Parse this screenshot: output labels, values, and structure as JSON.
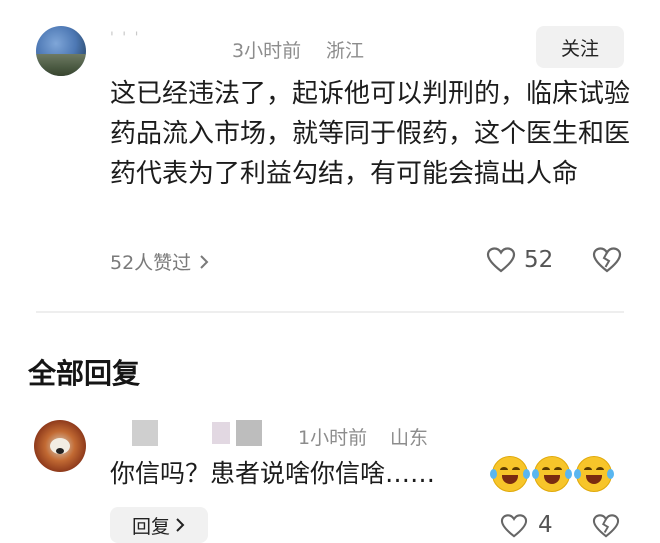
{
  "main_comment": {
    "username": "' ' '",
    "time": "3小时前",
    "location": "浙江",
    "follow_label": "关注",
    "text": "这已经违法了，起诉他可以判刑的，临床试验药品流入市场，就等同于假药，这个医生和医药代表为了利益勾结，有可能会搞出人命",
    "liked_by": "52人赞过",
    "like_count": "52"
  },
  "section_title": "全部回复",
  "reply": {
    "time": "1小时前",
    "location": "山东",
    "text": "你信吗？患者说啥你信啥……",
    "emoji_names": [
      "tears-of-joy-emoji",
      "tears-of-joy-emoji",
      "tears-of-joy-emoji"
    ],
    "reply_label": "回复",
    "like_count": "4"
  }
}
